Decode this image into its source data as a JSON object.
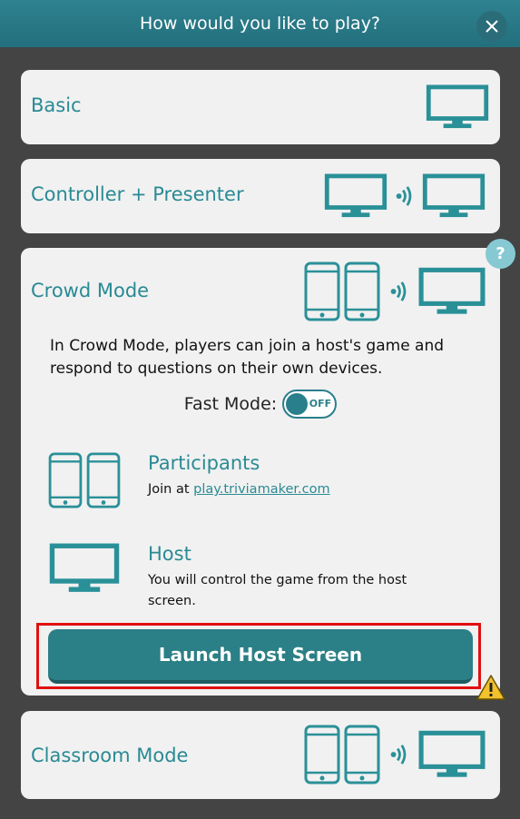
{
  "header": {
    "title": "How would you like to play?"
  },
  "modes": {
    "basic": {
      "label": "Basic"
    },
    "controller": {
      "label": "Controller + Presenter"
    },
    "crowd": {
      "label": "Crowd Mode",
      "description": "In Crowd Mode, players can join a host's game and respond to questions on their own devices.",
      "fast_mode_label": "Fast Mode:",
      "fast_mode_state": "OFF",
      "participants": {
        "title": "Participants",
        "join_prefix": "Join at",
        "join_link": "play.triviamaker.com"
      },
      "host": {
        "title": "Host",
        "text": "You will control the game from the host screen."
      },
      "launch_label": "Launch Host Screen"
    },
    "classroom": {
      "label": "Classroom Mode"
    }
  },
  "help": {
    "label": "?"
  },
  "colors": {
    "accent": "#2a8a94",
    "button": "#2b7f86",
    "highlight": "#e01010",
    "warning": "#f2c12e"
  },
  "icons": [
    "close-icon",
    "monitor-icon",
    "signal-icon",
    "phone-icon",
    "help-icon",
    "warning-icon"
  ]
}
